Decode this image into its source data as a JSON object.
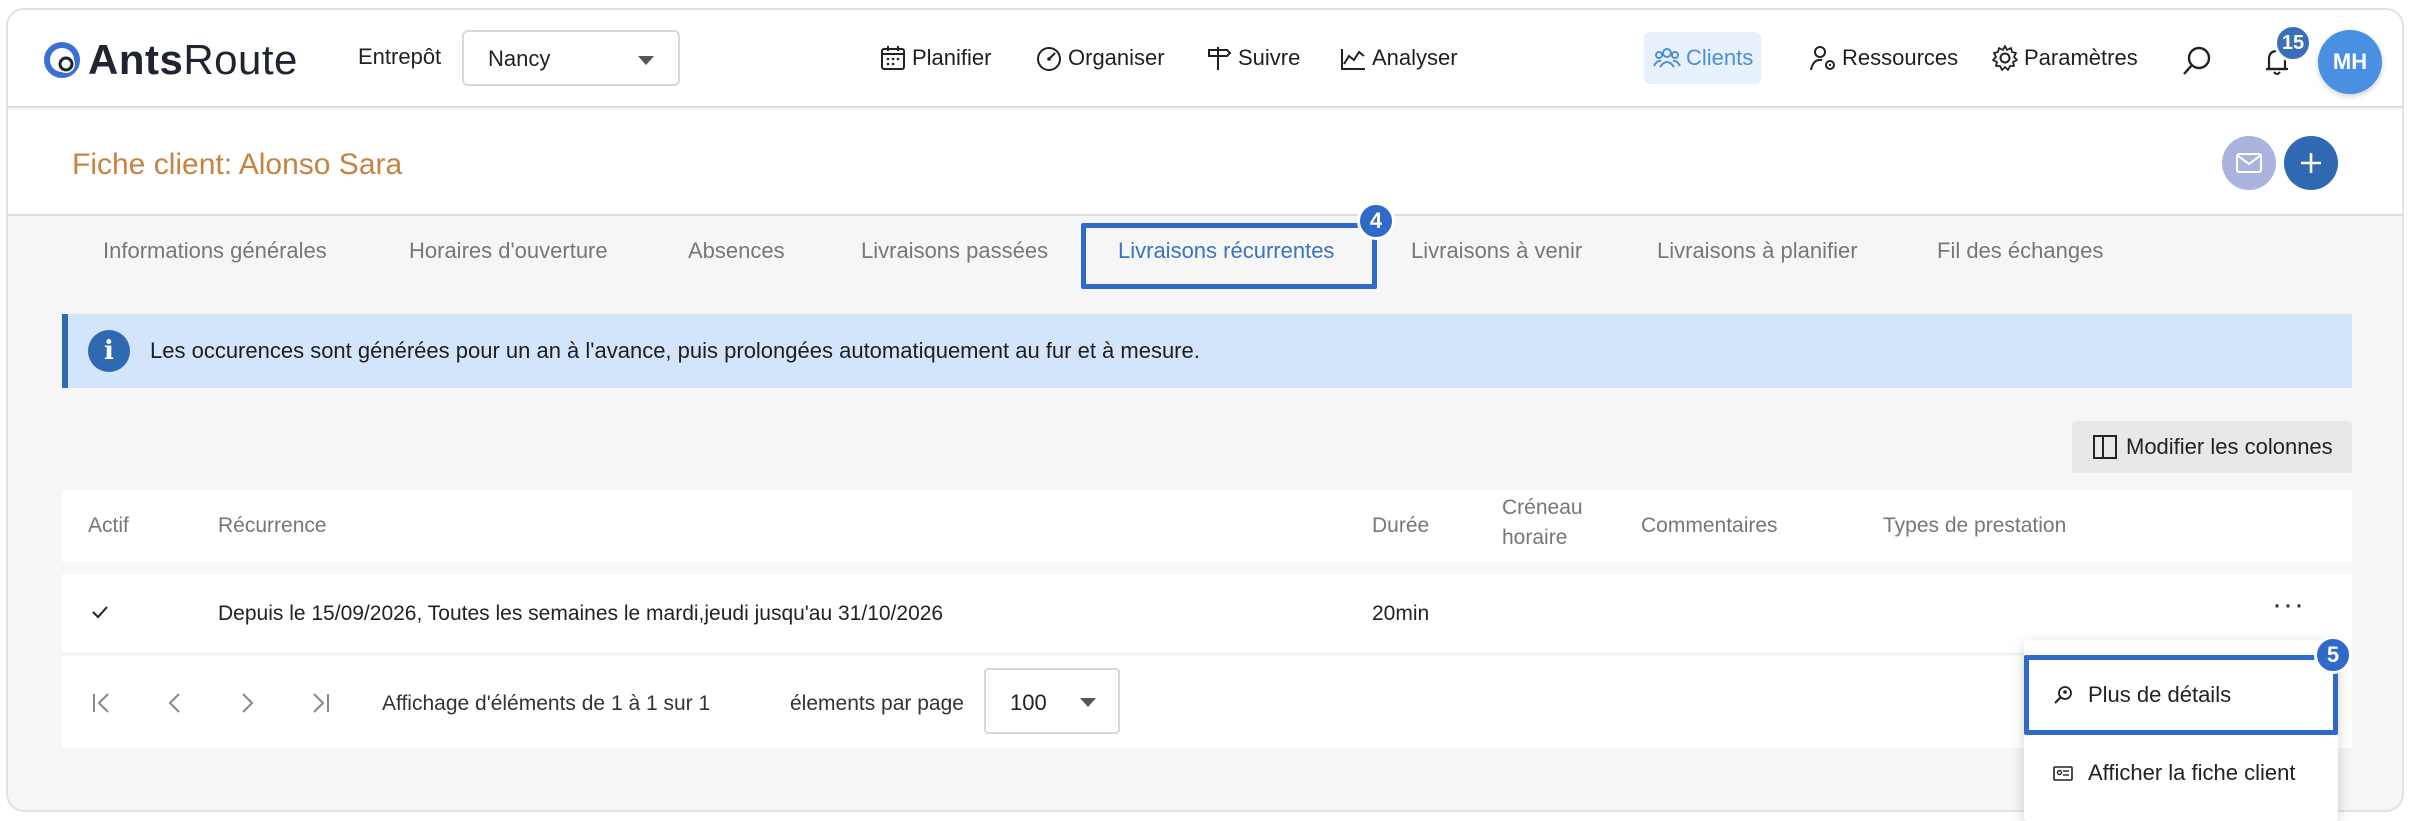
{
  "brand": {
    "name_bold": "Ants",
    "name_regular": "Route"
  },
  "warehouse": {
    "label": "Entrepôt",
    "value": "Nancy"
  },
  "nav": {
    "plan": "Planifier",
    "organize": "Organiser",
    "track": "Suivre",
    "analyze": "Analyser",
    "clients": "Clients",
    "resources": "Ressources",
    "settings": "Paramètres"
  },
  "notifications": {
    "count": "15"
  },
  "user": {
    "initials": "MH"
  },
  "page": {
    "title": "Fiche client: Alonso Sara"
  },
  "tabs": [
    {
      "label": "Informations générales"
    },
    {
      "label": "Horaires d'ouverture"
    },
    {
      "label": "Absences"
    },
    {
      "label": "Livraisons passées"
    },
    {
      "label": "Livraisons récurrentes"
    },
    {
      "label": "Livraisons à venir"
    },
    {
      "label": "Livraisons à planifier"
    },
    {
      "label": "Fil des échanges"
    }
  ],
  "info": {
    "icon": "i",
    "text": "Les occurences sont générées pour un an à l'avance, puis prolongées automatiquement au fur et à mesure."
  },
  "columns_button": "Modifier les colonnes",
  "table": {
    "headers": {
      "active": "Actif",
      "recurrence": "Récurrence",
      "duration": "Durée",
      "slot_line1": "Créneau",
      "slot_line2": "horaire",
      "comments": "Commentaires",
      "service_types": "Types de prestation"
    },
    "rows": [
      {
        "active": true,
        "recurrence": "Depuis le 15/09/2026, Toutes les semaines le mardi,jeudi jusqu'au 31/10/2026",
        "duration": "20min",
        "slot": "",
        "comments": "",
        "service_types": "",
        "actions": "···"
      }
    ]
  },
  "pagination": {
    "summary": "Affichage d'éléments de 1 à 1 sur 1",
    "per_page_label": "élements par page",
    "per_page_value": "100"
  },
  "row_menu": [
    {
      "label": "Plus de détails",
      "icon": "magnify-person-icon"
    },
    {
      "label": "Afficher la fiche client",
      "icon": "id-card-icon"
    }
  ],
  "step_badges": {
    "tab": "4",
    "menu": "5"
  },
  "colors": {
    "accent": "#2f69b2",
    "highlight": "#2f69c9",
    "title": "#c8823f",
    "info_bg": "#d3e5fb"
  }
}
